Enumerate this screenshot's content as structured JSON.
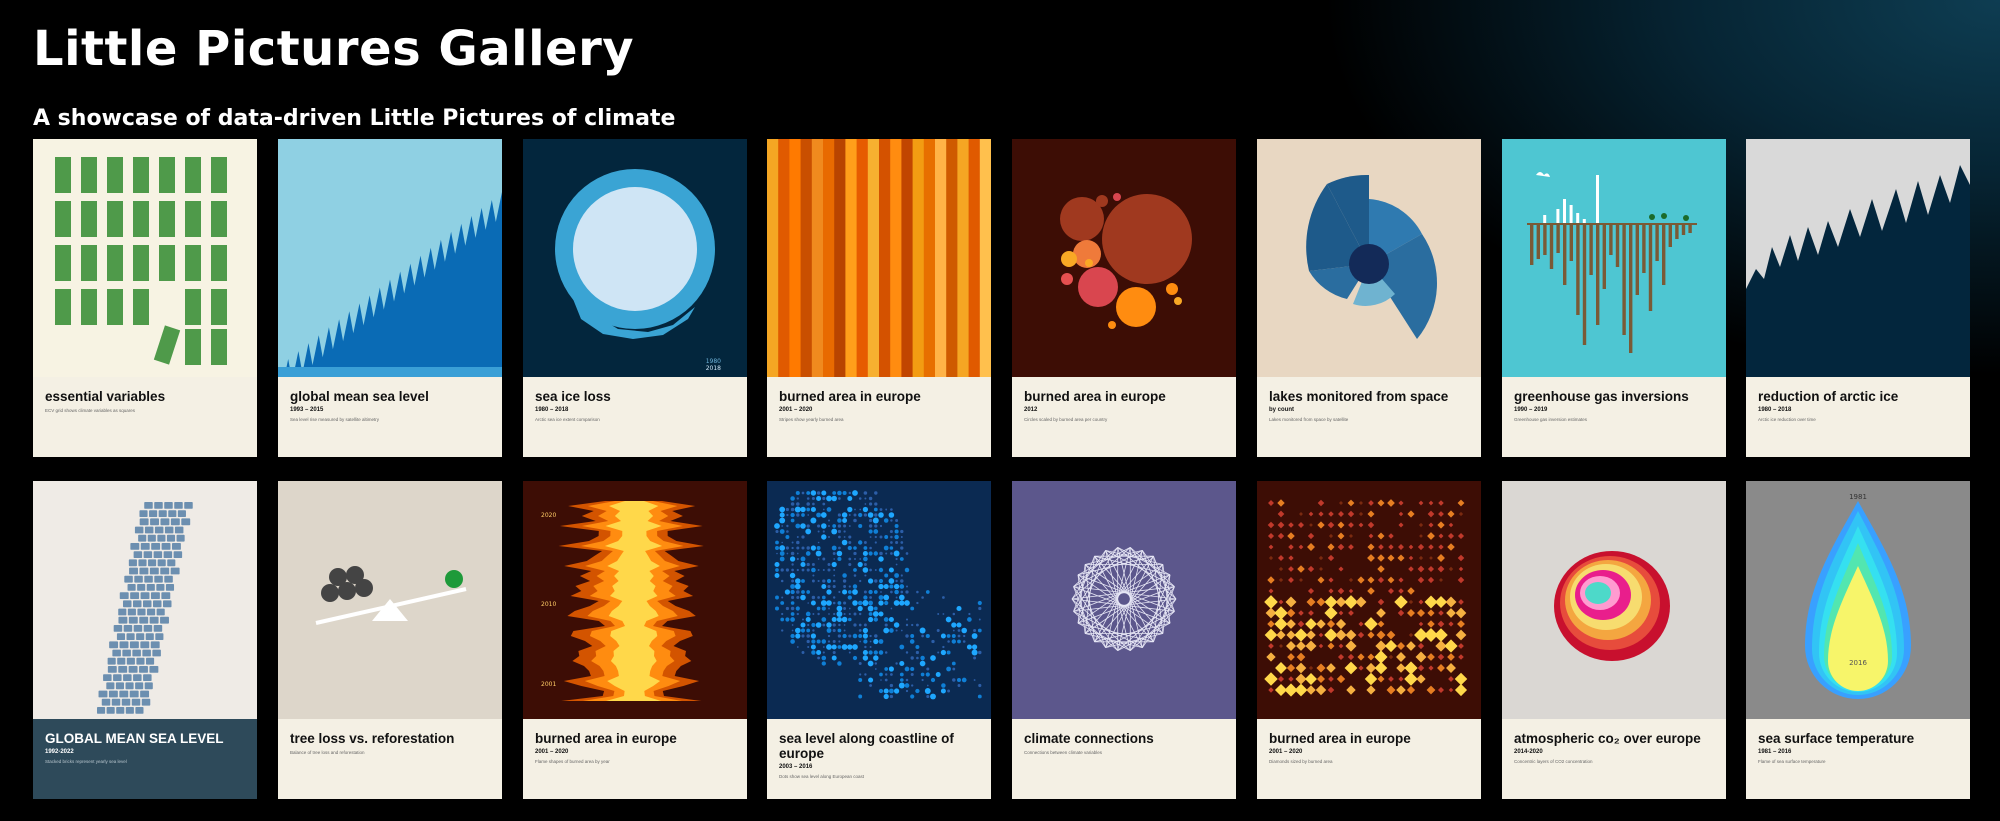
{
  "page": {
    "title": "Little Pictures Gallery",
    "subtitle": "A showcase of data-driven Little Pictures of climate"
  },
  "cards": [
    {
      "title": "essential variables",
      "years": "",
      "desc": "ECV grid shows climate variables as squares"
    },
    {
      "title": "global mean sea level",
      "years": "1993 – 2015",
      "desc": "Sea level rise measured by satellite altimetry"
    },
    {
      "title": "sea ice loss",
      "years": "1980 – 2018",
      "desc": "Arctic sea ice extent comparison"
    },
    {
      "title": "burned area in europe",
      "years": "2001 – 2020",
      "desc": "Stripes show yearly burned area"
    },
    {
      "title": "burned area in europe",
      "years": "2012",
      "desc": "Circles scaled by burned area per country"
    },
    {
      "title": "lakes monitored from space",
      "years": "by count",
      "desc": "Lakes monitored from space by satellite"
    },
    {
      "title": "greenhouse gas inversions",
      "years": "1990 – 2019",
      "desc": "Greenhouse gas inversion estimates"
    },
    {
      "title": "reduction of arctic ice",
      "years": "1980 – 2018",
      "desc": "Arctic ice reduction over time"
    },
    {
      "title": "GLOBAL MEAN SEA LEVEL",
      "years": "1992-2022",
      "desc": "Stacked bricks represent yearly sea level"
    },
    {
      "title": "tree loss vs. reforestation",
      "years": "",
      "desc": "Balance of tree loss and reforestation"
    },
    {
      "title": "burned area in europe",
      "years": "2001 – 2020",
      "desc": "Flame shapes of burned area by year"
    },
    {
      "title": "sea level along coastline of europe",
      "years": "2003 – 2016",
      "desc": "Dots show sea level along European coast"
    },
    {
      "title": "climate connections",
      "years": "",
      "desc": "Connections between climate variables"
    },
    {
      "title": "burned area in europe",
      "years": "2001 – 2020",
      "desc": "Diamonds sized by burned area"
    },
    {
      "title": "atmospheric co₂ over europe",
      "years": "2014-2020",
      "desc": "Concentric layers of CO2 concentration"
    },
    {
      "title": "sea surface temperature",
      "years": "1981 – 2016",
      "desc": "Flame of sea surface temperature"
    }
  ],
  "labels": {
    "sea_ice_years": [
      "1980",
      "2018"
    ],
    "flame_years": [
      "2020",
      "2010",
      "2001"
    ],
    "sst_years": [
      "1981",
      "2016"
    ]
  },
  "colors": {
    "green": "#4f9a4a",
    "sea_blue": "#0a6bb5",
    "ice_ring": "#3aa4d4",
    "orange": "#ff8c10",
    "dark_red": "#3d0d05"
  }
}
